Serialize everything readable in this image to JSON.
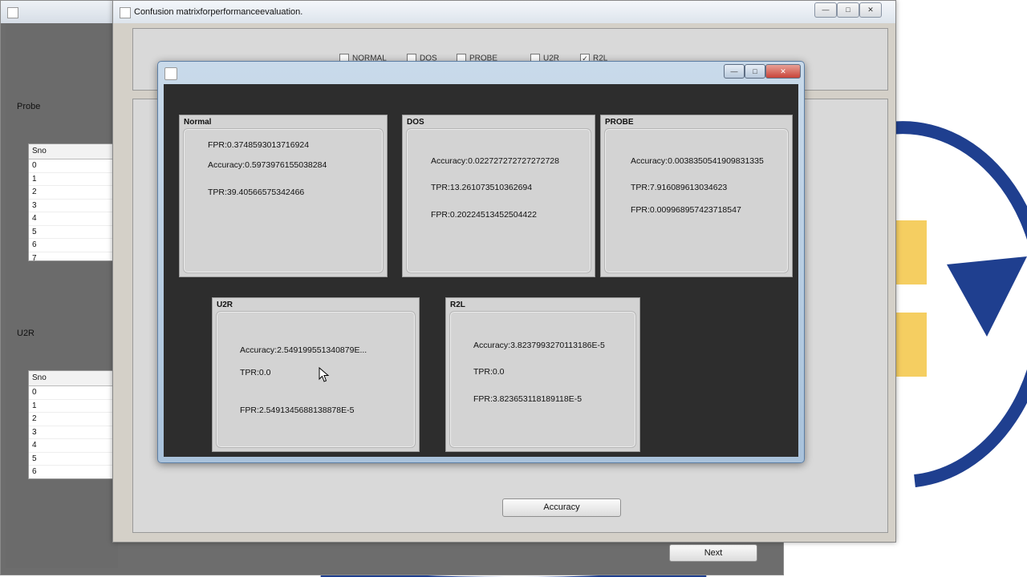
{
  "main_window": {
    "title": "Confusion matrixforperformanceevaluation."
  },
  "back_window": {
    "sections": [
      {
        "label": "Probe",
        "list_header": "Sno",
        "rows": [
          "0",
          "1",
          "2",
          "3",
          "4",
          "5",
          "6",
          "7"
        ]
      },
      {
        "label": "U2R",
        "list_header": "Sno",
        "rows": [
          "0",
          "1",
          "2",
          "3",
          "4",
          "5",
          "6"
        ]
      }
    ],
    "next_label": "Next"
  },
  "filters": [
    {
      "label": "NORMAL",
      "checked": false
    },
    {
      "label": "DOS",
      "checked": false
    },
    {
      "label": "PROBE",
      "checked": false
    },
    {
      "label": "U2R",
      "checked": false
    },
    {
      "label": "R2L",
      "checked": true
    }
  ],
  "accuracy_button": "Accuracy",
  "cards": {
    "normal": {
      "title": "Normal",
      "fpr": "FPR:0.3748593013716924",
      "accuracy": "Accuracy:0.5973976155038284",
      "tpr": "TPR:39.40566575342466"
    },
    "dos": {
      "title": "DOS",
      "accuracy": "Accuracy:0.022727272727272728",
      "tpr": "TPR:13.261073510362694",
      "fpr": "FPR:0.20224513452504422"
    },
    "probe": {
      "title": "PROBE",
      "accuracy": "Accuracy:0.0038350541909831335",
      "tpr": "TPR:7.916089613034623",
      "fpr": "FPR:0.009968957423718547"
    },
    "u2r": {
      "title": "U2R",
      "accuracy": "Accuracy:2.549199551340879E...",
      "tpr": "TPR:0.0",
      "fpr": "FPR:2.5491345688138878E-5"
    },
    "r2l": {
      "title": "R2L",
      "accuracy": "Accuracy:3.8237993270113186E-5",
      "tpr": "TPR:0.0",
      "fpr": "FPR:3.823653118189118E-5"
    }
  },
  "colors": {
    "logo_blue": "#1f3f8f",
    "logo_yellow": "#f2c23a",
    "dialog_bg": "#2d2d2d",
    "close_red": "#c8443a"
  }
}
